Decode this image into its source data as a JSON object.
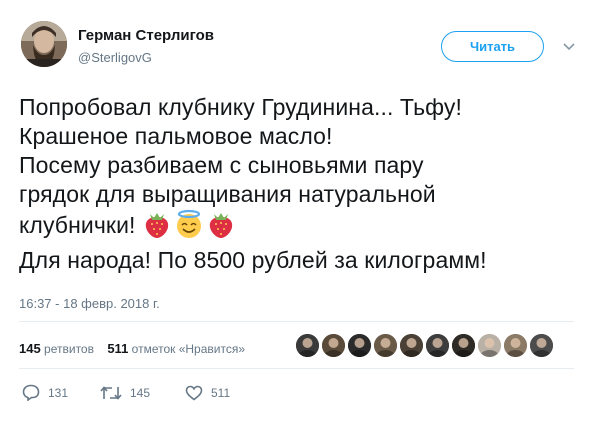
{
  "author": {
    "name": "Герман Стерлигов",
    "handle": "@SterligovG"
  },
  "follow_button": {
    "label": "Читать"
  },
  "tweet": {
    "lines": [
      "Попробовал клубнику Грудинина... Тьфу!",
      "Крашеное пальмовое масло!",
      "Посему разбиваем с сыновьями пару",
      "грядок для выращивания натуральной",
      "клубнички!",
      "Для народа! По 8500 рублей за килограмм!"
    ],
    "emoji": [
      "strawberry",
      "smiling-face-with-halo",
      "strawberry"
    ],
    "timestamp": "16:37 - 18 февр. 2018 г."
  },
  "stats": {
    "retweets_count": "145",
    "retweets_label": "ретвитов",
    "likes_count": "511",
    "likes_label": "отметок «Нравится»"
  },
  "likers": [
    {
      "color": "#3a3a3a"
    },
    {
      "color": "#5a4a3a"
    },
    {
      "color": "#2b2b2b"
    },
    {
      "color": "#6a5a48"
    },
    {
      "color": "#4a4035"
    },
    {
      "color": "#3d3d3d"
    },
    {
      "color": "#2e2a26"
    },
    {
      "color": "#b9b1a6"
    },
    {
      "color": "#8a7a66"
    },
    {
      "color": "#4c4c4c"
    }
  ],
  "actions": {
    "reply": {
      "icon": "reply-icon",
      "count": "131"
    },
    "retweet": {
      "icon": "retweet-icon",
      "count": "145"
    },
    "like": {
      "icon": "heart-icon",
      "count": "511"
    }
  },
  "colors": {
    "accent": "#1da1f2",
    "muted": "#657786",
    "text": "#14171a",
    "divider": "#e6ecf0"
  }
}
